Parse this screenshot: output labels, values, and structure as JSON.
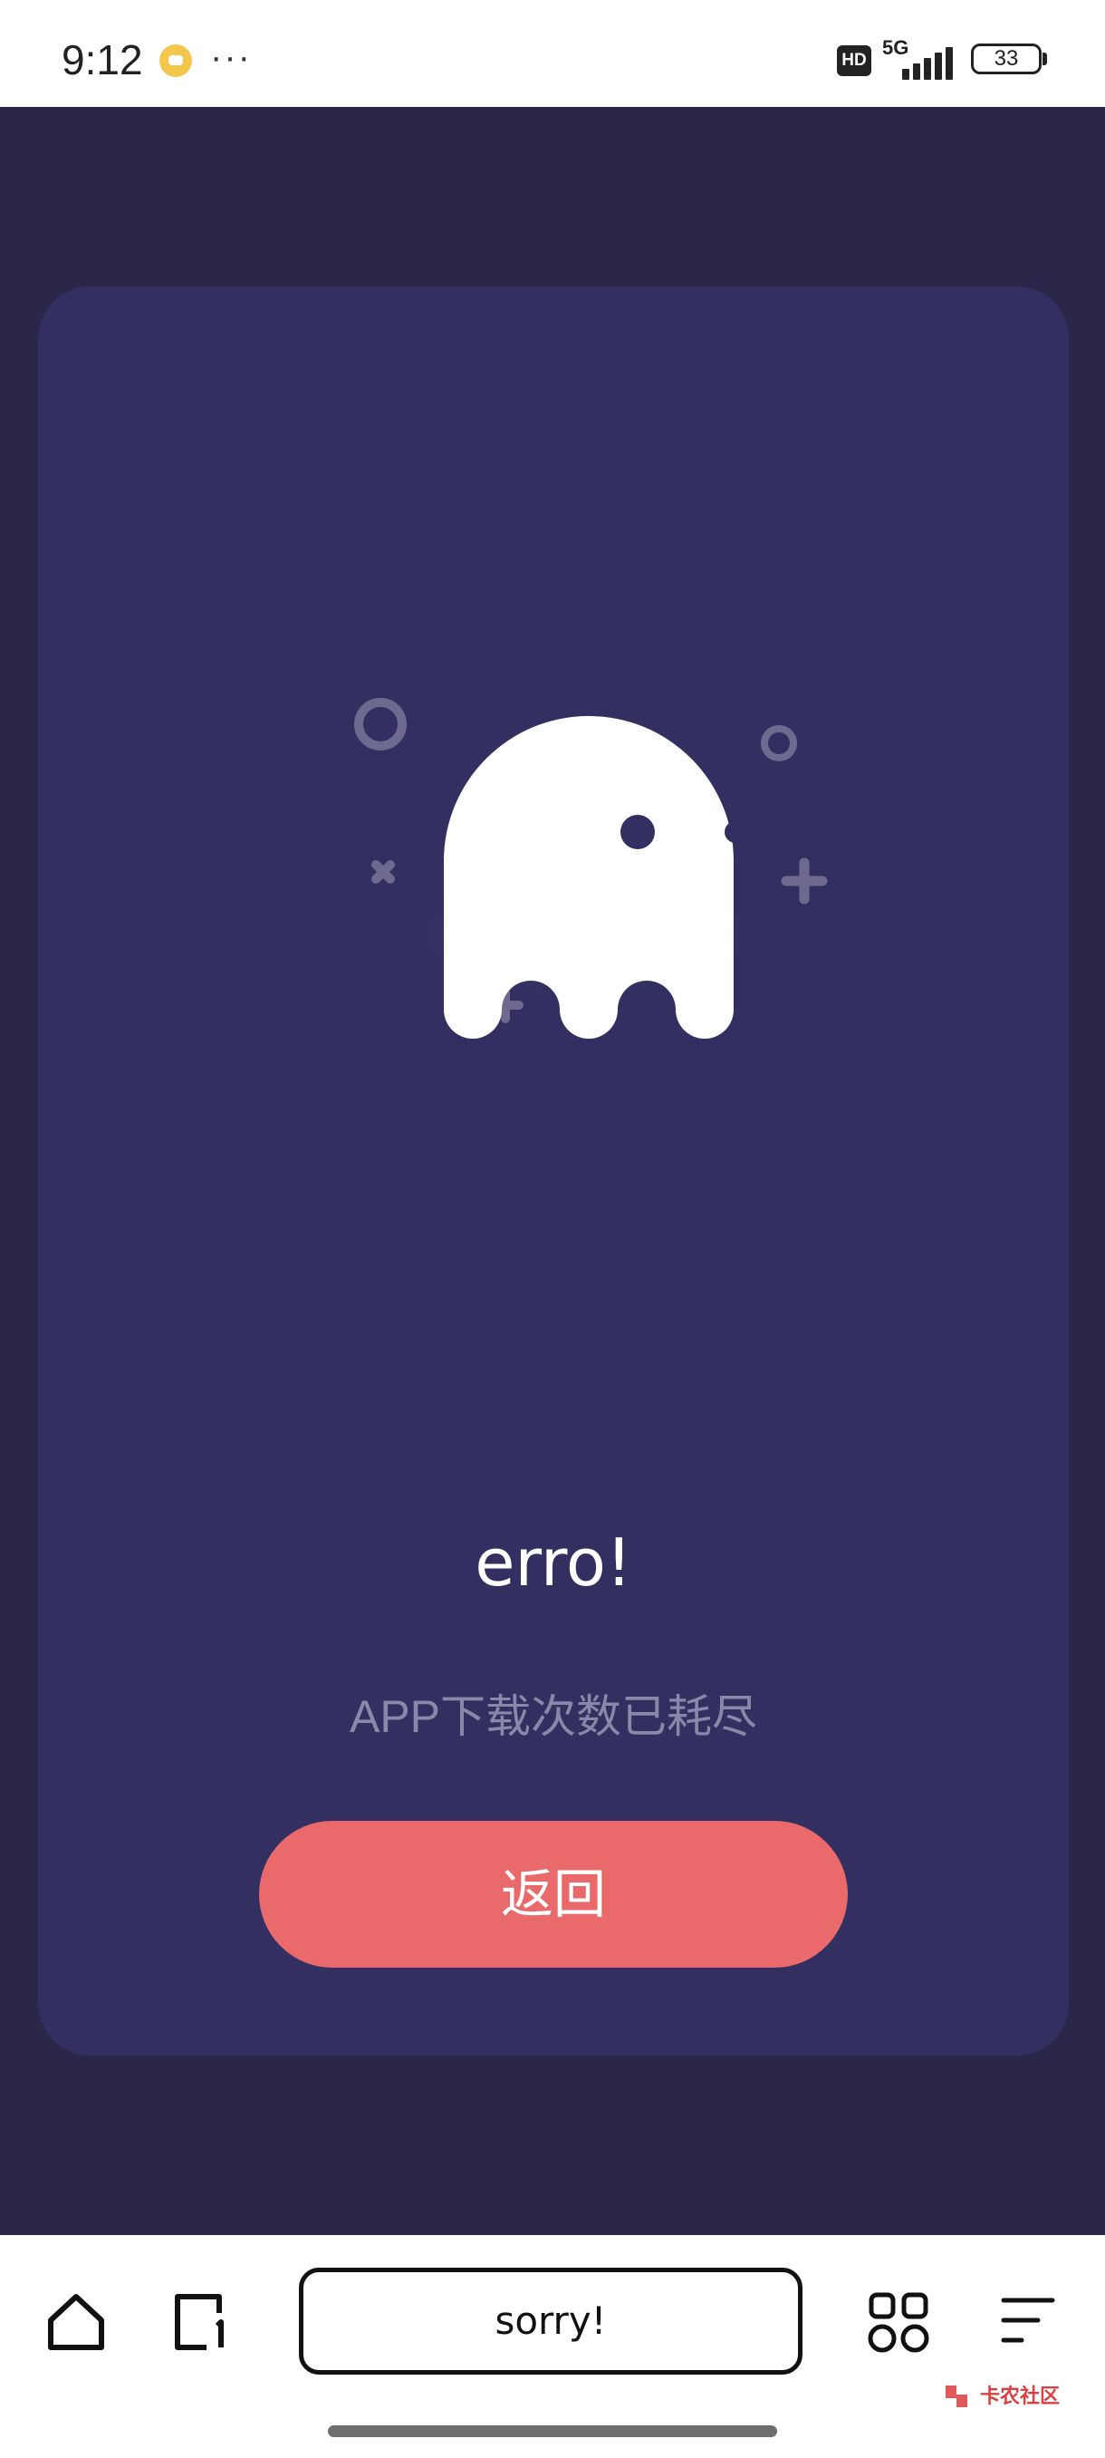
{
  "status_bar": {
    "time": "9:12",
    "network_badge": "HD",
    "network_type": "5G",
    "battery_level": "33",
    "more_dots": "···"
  },
  "error_page": {
    "title": "erro!",
    "message": "APP下载次数已耗尽",
    "back_button_label": "返回"
  },
  "browser_bar": {
    "address_text": "sorry!",
    "icons": [
      "home-icon",
      "tabs-icon",
      "apps-icon",
      "menu-icon"
    ]
  },
  "watermark": {
    "text": "卡农社区"
  },
  "colors": {
    "page_background": "#2b2748",
    "card_background": "#332f61",
    "button": "#ea6a6b",
    "message_text": "#8a87a8"
  }
}
